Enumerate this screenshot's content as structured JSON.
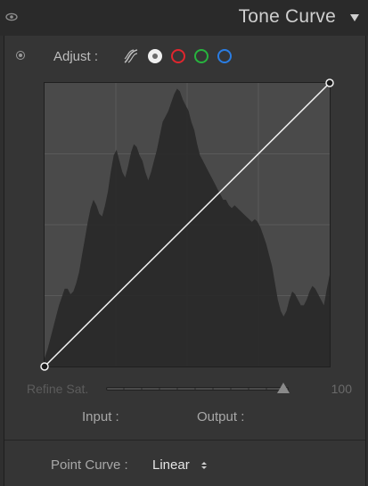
{
  "header": {
    "title": "Tone Curve"
  },
  "adjust": {
    "label": "Adjust :",
    "channels": [
      "parametric",
      "point",
      "red",
      "green",
      "blue"
    ],
    "active_channel": "point",
    "channel_colors": {
      "red": "#e0262e",
      "green": "#27b43e",
      "blue": "#2a7de3"
    }
  },
  "curve": {
    "points": [
      [
        0,
        0
      ],
      [
        255,
        255
      ]
    ],
    "histogram": [
      3,
      6,
      10,
      14,
      18,
      22,
      25,
      28,
      28,
      26,
      27,
      30,
      34,
      40,
      46,
      52,
      57,
      60,
      58,
      55,
      54,
      58,
      63,
      70,
      76,
      78,
      74,
      70,
      68,
      72,
      77,
      80,
      79,
      76,
      74,
      70,
      67,
      70,
      74,
      78,
      83,
      88,
      90,
      92,
      95,
      98,
      100,
      99,
      96,
      94,
      92,
      88,
      85,
      80,
      76,
      74,
      72,
      70,
      68,
      66,
      64,
      62,
      60,
      60,
      58,
      57,
      58,
      57,
      56,
      55,
      54,
      53,
      52,
      53,
      52,
      50,
      47,
      44,
      40,
      36,
      30,
      24,
      20,
      18,
      20,
      24,
      27,
      26,
      24,
      22,
      22,
      24,
      27,
      29,
      28,
      26,
      24,
      22,
      28,
      33
    ]
  },
  "refine": {
    "label": "Refine Sat.",
    "value": "100",
    "level": 1.0
  },
  "readout": {
    "input_label": "Input :",
    "output_label": "Output :"
  },
  "point_curve": {
    "label": "Point Curve :",
    "selected": "Linear"
  }
}
